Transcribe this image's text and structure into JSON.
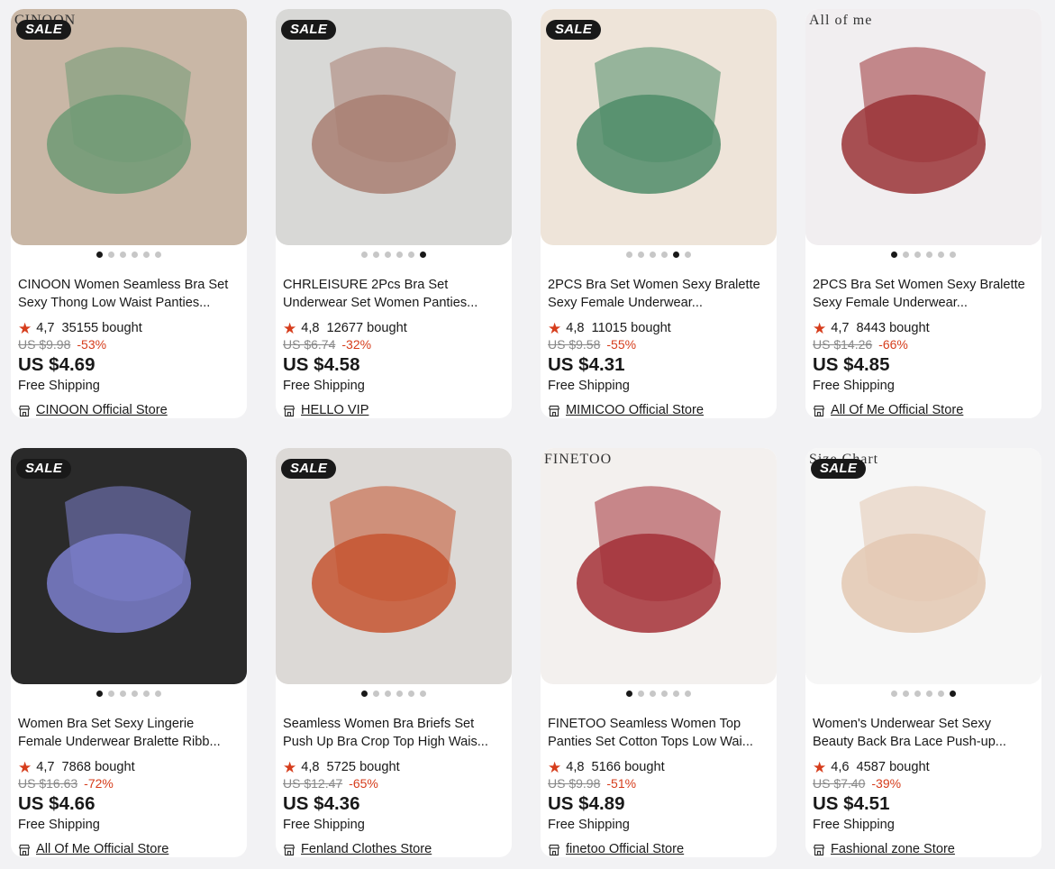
{
  "products": [
    {
      "sale_label": "SALE",
      "brand_mark": "CINOON",
      "title": "CINOON Women Seamless Bra Set Sexy Thong Low Waist Panties...",
      "rating": "4,7",
      "sold": "35155 bought",
      "old_price": "US $9.98",
      "discount": "-53%",
      "price": "US $4.69",
      "shipping": "Free Shipping",
      "store": "CINOON Official Store",
      "dots": 6,
      "active_dot": 0
    },
    {
      "sale_label": "SALE",
      "brand_mark": "",
      "title": "CHRLEISURE 2Pcs Bra Set Underwear Set Women Panties...",
      "rating": "4,8",
      "sold": "12677 bought",
      "old_price": "US $6.74",
      "discount": "-32%",
      "price": "US $4.58",
      "shipping": "Free Shipping",
      "store": "HELLO VIP",
      "dots": 6,
      "active_dot": 5
    },
    {
      "sale_label": "SALE",
      "brand_mark": "",
      "title": "2PCS Bra Set Women Sexy Bralette Sexy Female Underwear...",
      "rating": "4,8",
      "sold": "11015 bought",
      "old_price": "US $9.58",
      "discount": "-55%",
      "price": "US $4.31",
      "shipping": "Free Shipping",
      "store": "MIMICOO Official Store",
      "dots": 6,
      "active_dot": 4
    },
    {
      "sale_label": "",
      "brand_mark": "All of me",
      "title": "2PCS Bra Set Women Sexy Bralette Sexy Female Underwear...",
      "rating": "4,7",
      "sold": "8443 bought",
      "old_price": "US $14.26",
      "discount": "-66%",
      "price": "US $4.85",
      "shipping": "Free Shipping",
      "store": "All Of Me Official Store",
      "dots": 6,
      "active_dot": 0
    },
    {
      "sale_label": "SALE",
      "brand_mark": "",
      "title": "Women Bra Set Sexy Lingerie Female Underwear Bralette Ribb...",
      "rating": "4,7",
      "sold": "7868 bought",
      "old_price": "US $16.63",
      "discount": "-72%",
      "price": "US $4.66",
      "shipping": "Free Shipping",
      "store": "All Of Me Official Store",
      "dots": 6,
      "active_dot": 0
    },
    {
      "sale_label": "SALE",
      "brand_mark": "",
      "title": "Seamless Women Bra Briefs Set Push Up Bra Crop Top High Wais...",
      "rating": "4,8",
      "sold": "5725 bought",
      "old_price": "US $12.47",
      "discount": "-65%",
      "price": "US $4.36",
      "shipping": "Free Shipping",
      "store": "Fenland Clothes Store",
      "dots": 6,
      "active_dot": 0
    },
    {
      "sale_label": "",
      "brand_mark": "FINETOO",
      "title": "FINETOO Seamless Women Top Panties Set Cotton Tops Low Wai...",
      "rating": "4,8",
      "sold": "5166 bought",
      "old_price": "US $9.98",
      "discount": "-51%",
      "price": "US $4.89",
      "shipping": "Free Shipping",
      "store": "finetoo Official Store",
      "dots": 6,
      "active_dot": 0
    },
    {
      "sale_label": "SALE",
      "brand_mark": "Size Chart",
      "title": "Women's Underwear Set Sexy Beauty Back Bra Lace Push-up...",
      "rating": "4,6",
      "sold": "4587 bought",
      "old_price": "US $7.40",
      "discount": "-39%",
      "price": "US $4.51",
      "shipping": "Free Shipping",
      "store": "Fashional zone Store",
      "dots": 6,
      "active_dot": 5
    }
  ],
  "colors": {
    "accent": "#d63d1c",
    "text": "#191919",
    "muted": "#888888",
    "background": "#f2f2f4"
  },
  "images": [
    {
      "c1": "#c9b7a6",
      "c2": "#6f9a74"
    },
    {
      "c1": "#d8d8d6",
      "c2": "#a97f72"
    },
    {
      "c1": "#eee4d9",
      "c2": "#4f8c68"
    },
    {
      "c1": "#f1eef0",
      "c2": "#9a3336"
    },
    {
      "c1": "#2a2a2a",
      "c2": "#7b7fcc"
    },
    {
      "c1": "#dcd9d6",
      "c2": "#c55330"
    },
    {
      "c1": "#f3f0ee",
      "c2": "#a33036"
    },
    {
      "c1": "#f6f6f6",
      "c2": "#e3c8b2"
    }
  ]
}
